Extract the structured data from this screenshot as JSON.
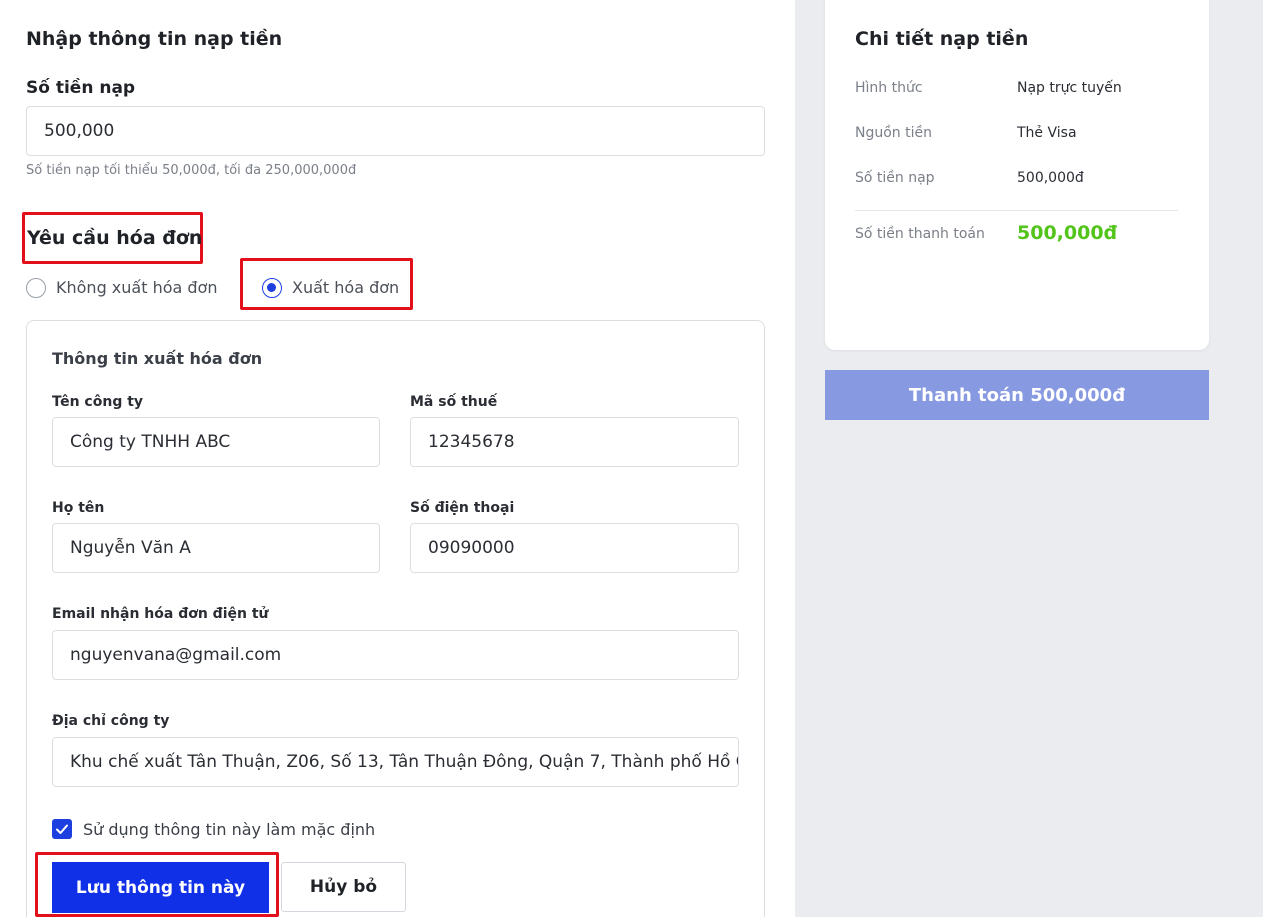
{
  "form": {
    "title": "Nhập thông tin nạp tiền",
    "amount_label": "Số tiền nạp",
    "amount_value": "500,000",
    "amount_hint": "Số tiền nạp tối thiểu 50,000đ, tối đa 250,000,000đ",
    "invoice_title": "Yêu cầu hóa đơn",
    "invoice_options": [
      {
        "label": "Không xuất hóa đơn",
        "selected": false
      },
      {
        "label": "Xuất hóa đơn",
        "selected": true
      }
    ]
  },
  "invoice_card": {
    "title": "Thông tin xuất hóa đơn",
    "company_label": "Tên công ty",
    "company_value": "Công ty TNHH ABC",
    "tax_label": "Mã số thuế",
    "tax_value": "12345678",
    "name_label": "Họ tên",
    "name_value": "Nguyễn Văn A",
    "phone_label": "Số điện thoại",
    "phone_value": "09090000",
    "email_label": "Email nhận hóa đơn điện tử",
    "email_value": "nguyenvana@gmail.com",
    "address_label": "Địa chỉ công ty",
    "address_value": "Khu chế xuất Tân Thuận, Z06, Số 13, Tân Thuận Đông, Quận 7, Thành phố Hồ Chí Minh",
    "default_checkbox_label": "Sử dụng thông tin này làm mặc định",
    "default_checked": true,
    "save_button": "Lưu thông tin này",
    "cancel_button": "Hủy bỏ"
  },
  "summary": {
    "title": "Chi tiết nạp tiền",
    "rows": [
      {
        "key": "Hình thức",
        "value": "Nạp trực tuyến"
      },
      {
        "key": "Nguồn tiền",
        "value": "Thẻ Visa"
      },
      {
        "key": "Số tiền nạp",
        "value": "500,000đ"
      }
    ],
    "total_key": "Số tiền thanh toán",
    "total_value": "500,000đ",
    "pay_button": "Thanh toán 500,000đ"
  },
  "colors": {
    "accent": "#1030e8",
    "highlight": "#e3101b",
    "total_green": "#52c41a",
    "pay_disabled": "#8799e0"
  }
}
